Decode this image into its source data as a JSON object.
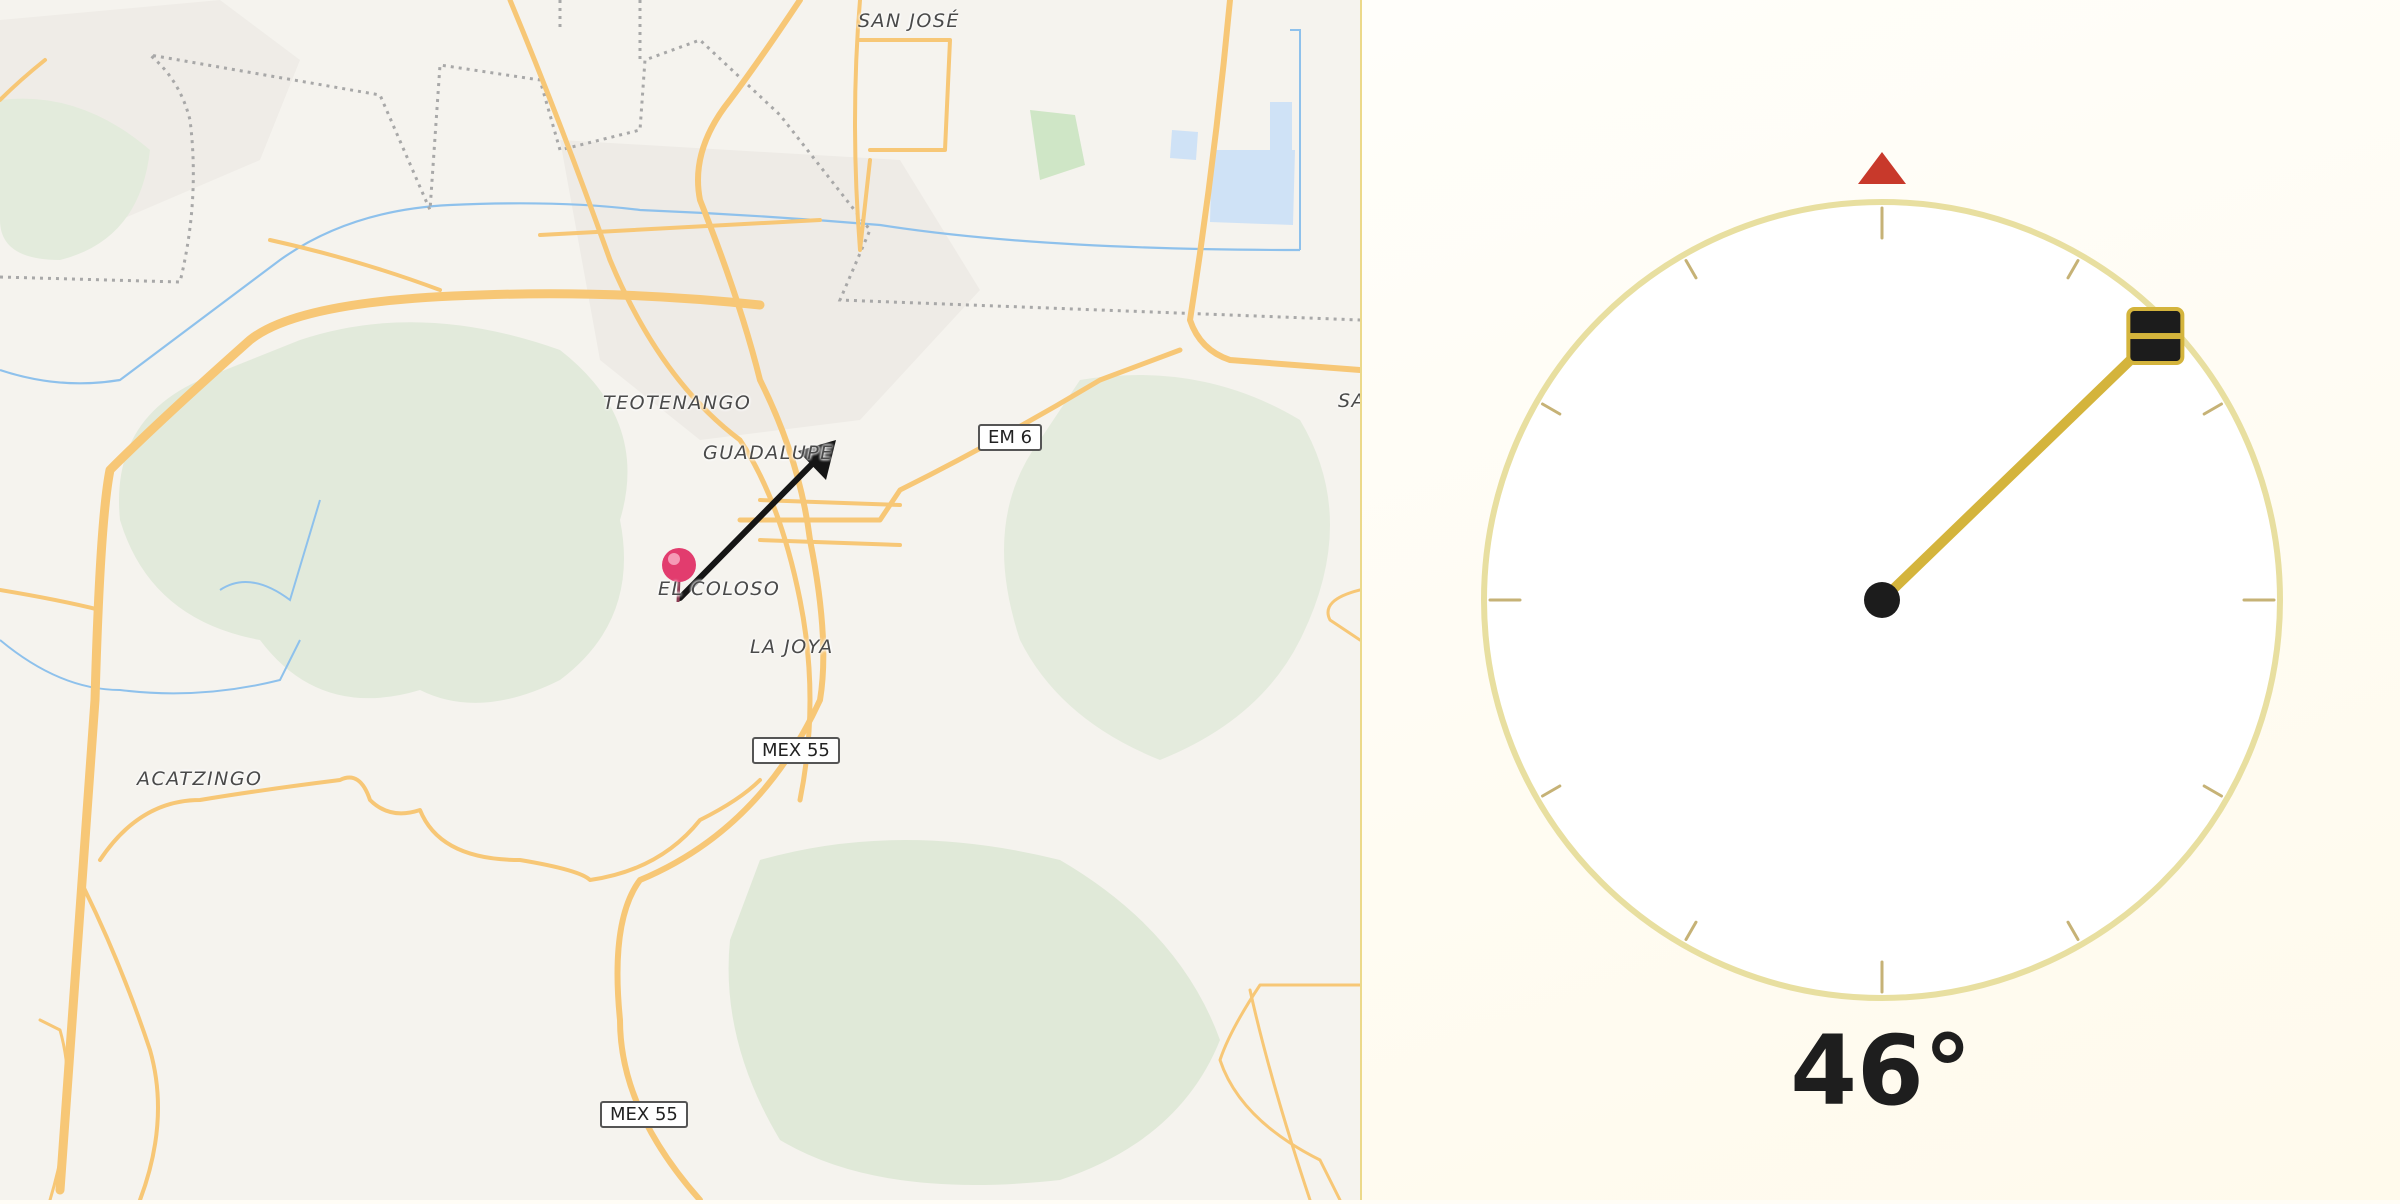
{
  "map": {
    "places": {
      "san_jose": "SAN JOSÉ",
      "teotenango": "TEOTENANGO",
      "guadalupe": "GUADALUPE",
      "el_coloso": "EL COLOSO",
      "la_joya": "LA JOYA",
      "acatzingo": "ACATZINGO",
      "sa": "SA"
    },
    "shields": {
      "em6": "EM 6",
      "mex55_a": "MEX 55",
      "mex55_b": "MEX 55"
    },
    "marker_icon": "map-pin-icon",
    "direction_icon": "direction-arrow-icon",
    "colors": {
      "road": "#f7c776",
      "water": "#8ec1ec",
      "park": "#e0ead8",
      "pin": "#e23c6e",
      "arrow": "#151515"
    }
  },
  "compass": {
    "heading": "46°",
    "heading_deg": 46,
    "north_icon": "north-indicator-icon",
    "colors": {
      "ring": "#e8dfa0",
      "needle": "#d4b43c",
      "north": "#c8392b",
      "handle": "#1c1c1c"
    }
  }
}
